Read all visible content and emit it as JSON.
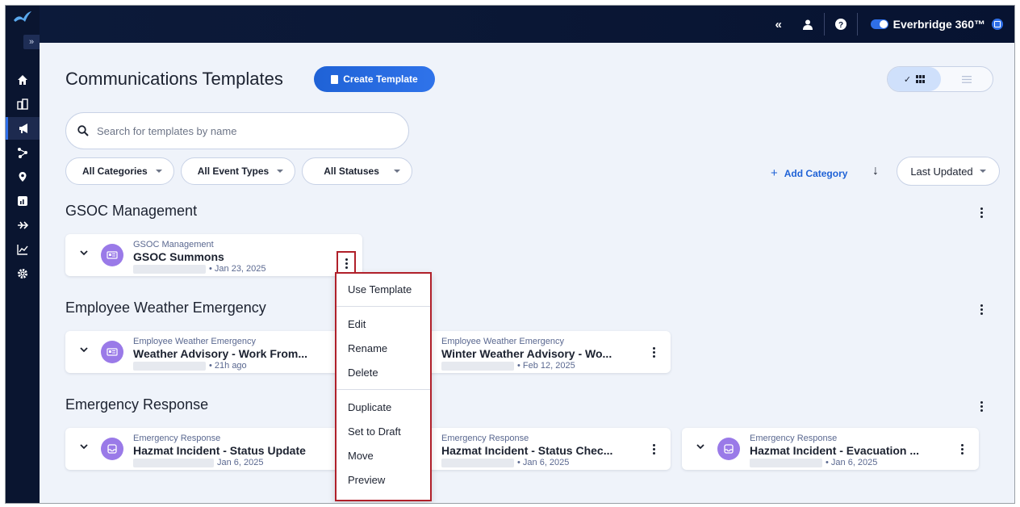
{
  "app": {
    "brand": "Everbridge 360™",
    "collapse_glyph": "«",
    "expand_glyph": "»"
  },
  "sidebar": {
    "items": [
      {
        "icon": "home-icon"
      },
      {
        "icon": "buildings-icon"
      },
      {
        "icon": "megaphone-icon",
        "active": true
      },
      {
        "icon": "workflow-icon"
      },
      {
        "icon": "location-pin-icon"
      },
      {
        "icon": "dashboard-icon"
      },
      {
        "icon": "flow-icon"
      },
      {
        "icon": "analytics-icon"
      },
      {
        "icon": "settings-icon"
      }
    ]
  },
  "page": {
    "title": "Communications Templates",
    "create_button": "Create Template",
    "search_placeholder": "Search for templates by name",
    "filters": [
      "All Categories",
      "All Event Types",
      "All Statuses"
    ],
    "add_category": "Add Category",
    "add_category_glyph": "+",
    "sort_arrow": "↓",
    "sort_label": "Last Updated",
    "view_grid_check": "✓"
  },
  "sections": [
    {
      "title": "GSOC Management",
      "cards": [
        {
          "category": "GSOC Management",
          "name": "GSOC Summons",
          "date": "• Jan 23, 2025",
          "icon": "id-card-icon"
        }
      ]
    },
    {
      "title": "Employee Weather Emergency",
      "cards": [
        {
          "category": "Employee Weather Emergency",
          "name": "Weather Advisory - Work From...",
          "date": "• 21h ago",
          "icon": "id-card-icon"
        },
        {
          "category": "Employee Weather Emergency",
          "name": "Winter Weather Advisory - Wo...",
          "date": "• Feb 12, 2025",
          "icon": "id-card-icon"
        }
      ]
    },
    {
      "title": "Emergency Response",
      "cards": [
        {
          "category": "Emergency Response",
          "name": "Hazmat Incident - Status Update",
          "date": "Jan 6, 2025",
          "icon": "inbox-icon"
        },
        {
          "category": "Emergency Response",
          "name": "Hazmat Incident - Status Chec...",
          "date": "• Jan 6, 2025",
          "icon": "inbox-icon"
        },
        {
          "category": "Emergency Response",
          "name": "Hazmat Incident - Evacuation ...",
          "date": "• Jan 6, 2025",
          "icon": "inbox-icon"
        }
      ]
    }
  ],
  "context_menu": {
    "items": [
      "Use Template",
      "Edit",
      "Rename",
      "Delete",
      "Duplicate",
      "Set to Draft",
      "Move",
      "Preview"
    ]
  },
  "colors": {
    "accent": "#1f62d6",
    "avatar": "#9a7ae8",
    "menu_border": "#b0202a",
    "topbar": "#0c1a3a"
  }
}
